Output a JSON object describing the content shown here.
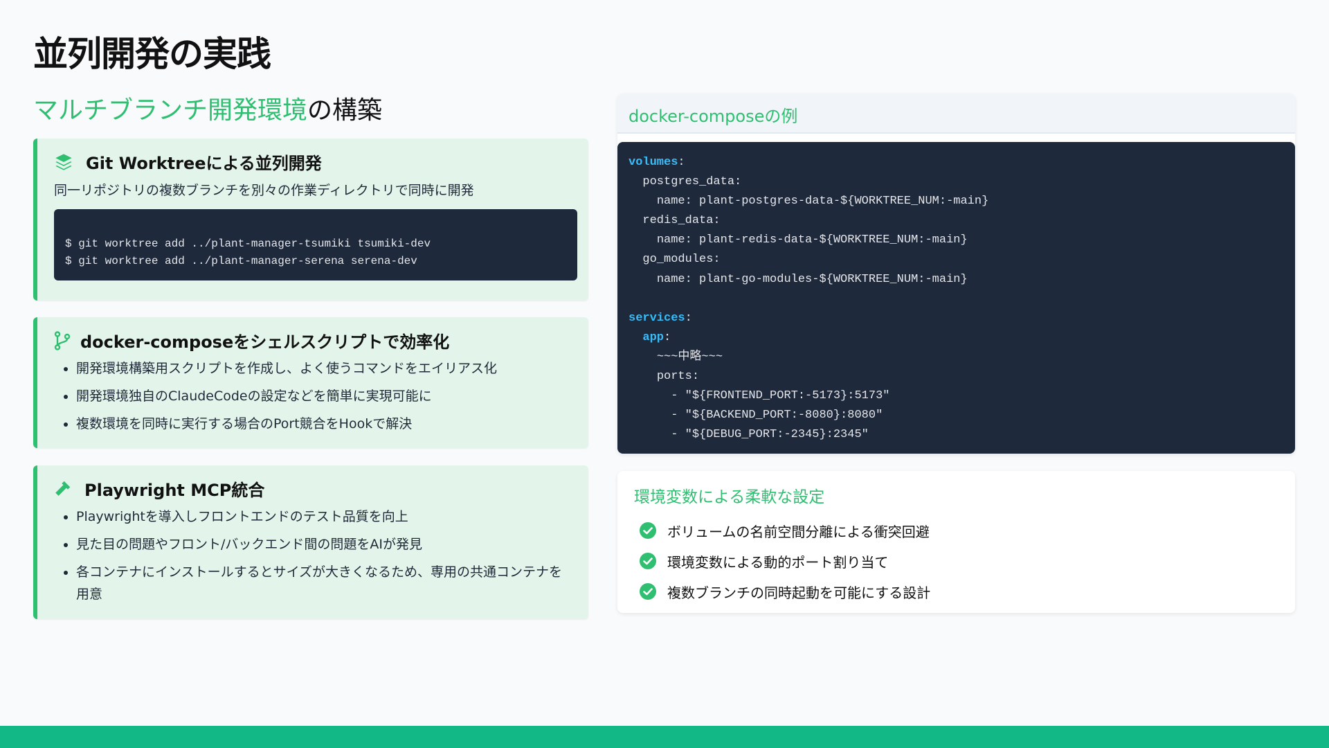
{
  "title": "並列開発の実践",
  "subtitle": {
    "accent": "マルチブランチ開発環境",
    "rest": "の構築"
  },
  "colors": {
    "accent": "#2fbf71",
    "footer": "#12b886",
    "code_bg": "#1e293b",
    "card_bg": "#e3f5eb"
  },
  "cards": [
    {
      "icon": "layers-icon",
      "heading": "Git Worktreeによる並列開発",
      "description": "同一リポジトリの複数ブランチを別々の作業ディレクトリで同時に開発",
      "code": [
        "$ git worktree add ../plant-manager-tsumiki tsumiki-dev",
        "$ git worktree add ../plant-manager-serena serena-dev"
      ]
    },
    {
      "icon": "git-branch-icon",
      "heading": "docker-composeをシェルスクリプトで効率化",
      "bullets": [
        "開発環境構築用スクリプトを作成し、よく使うコマンドをエイリアス化",
        "開発環境独自のClaudeCodeの設定などを簡単に実現可能に",
        "複数環境を同時に実行する場合のPort競合をHookで解決"
      ]
    },
    {
      "icon": "hammer-icon",
      "heading": "Playwright MCP統合",
      "bullets": [
        "Playwrightを導入しフロントエンドのテスト品質を向上",
        "見た目の問題やフロント/バックエンド間の問題をAIが発見",
        "各コンテナにインストールするとサイズが大きくなるため、専用の共通コンテナを用意"
      ]
    }
  ],
  "compose": {
    "title": "docker-composeの例",
    "code": {
      "volumes_key": "volumes",
      "l1": "postgres_data:",
      "l2": "name: plant-postgres-data-${WORKTREE_NUM:-main}",
      "l3": "redis_data:",
      "l4": "name: plant-redis-data-${WORKTREE_NUM:-main}",
      "l5": "go_modules:",
      "l6": "name: plant-go-modules-${WORKTREE_NUM:-main}",
      "services_key": "services",
      "app_key": "app",
      "l9": "~~~中略~~~",
      "l10": "ports:",
      "l11": "- \"${FRONTEND_PORT:-5173}:5173\"",
      "l12": "- \"${BACKEND_PORT:-8080}:8080\"",
      "l13": "- \"${DEBUG_PORT:-2345}:2345\""
    }
  },
  "env": {
    "title": "環境変数による柔軟な設定",
    "items": [
      "ボリュームの名前空間分離による衝突回避",
      "環境変数による動的ポート割り当て",
      "複数ブランチの同時起動を可能にする設計"
    ]
  }
}
